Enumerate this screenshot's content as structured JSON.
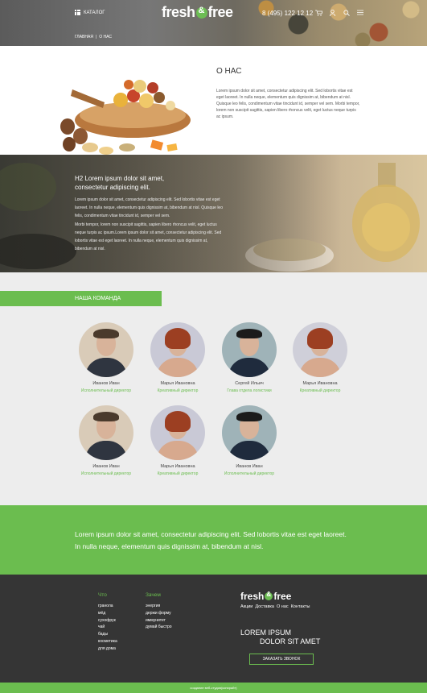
{
  "header": {
    "catalog_label": "КАТАЛОГ",
    "logo_left": "fresh",
    "logo_right": "free",
    "phone": "8 (495) 122 12 12",
    "icons": [
      "cart-icon",
      "user-icon",
      "search-icon",
      "menu-icon"
    ],
    "breadcrumbs": [
      "ГЛАВНАЯ",
      "|",
      "О НАС"
    ]
  },
  "about": {
    "title": "О НАС",
    "text": "Lorem ipsum dolor sit amet, consectetur adipiscing elit. Sed lobortis vitae est eget laoreet. In nulla neque, elementum quis dignissim at, bibendum at nisl. Quisque leo felis, condimentum vitae tincidunt id, semper vel sem. Morbi tempor, lorem non suscipit sagittis, sapien libero rhoncus velit, eget luctus neque turpis ac ipsum."
  },
  "spa": {
    "heading": "H2 Lorem ipsum dolor sit amet, consectetur adipiscing elit.",
    "p1": "Lorem ipsum dolor sit amet, consectetur adipiscing elit. Sed lobortis vitae est eget laoreet. In nulla neque, elementum quis dignissim at, bibendum at nisl. Quisque leo felis, condimentum vitae tincidunt id, semper vel sem.",
    "p2": "Morbi tempor, lorem non suscipit sagittis, sapien libero rhoncus velit, eget luctus neque turpis ac ipsum.Lorem ipsum dolor sit amet, consectetur adipiscing elit. Sed lobortis vitae est eget laoreet. In nulla neque, elementum quis dignissim at, bibendum at nisl."
  },
  "team": {
    "title": "НАША КОМАНДА",
    "members": [
      {
        "name": "Иванов Иван",
        "role": "Исполнительный директор"
      },
      {
        "name": "Марья Ивановна",
        "role": "Креативный директор"
      },
      {
        "name": "Сергей Ильич",
        "role": "Глава отдела логистики"
      },
      {
        "name": "Марья Ивановна",
        "role": "Креативный директор"
      },
      {
        "name": "Иванов Иван",
        "role": "Исполнительный директор"
      },
      {
        "name": "Марья Ивановна",
        "role": "Креативный директор"
      },
      {
        "name": "Иванов Иван",
        "role": "Исполнительный директор"
      }
    ]
  },
  "quote": {
    "text": "Lorem ipsum dolor sit amet, consectetur adipiscing elit. Sed lobortis vitae est eget laoreet. In nulla neque, elementum quis dignissim at, bibendum at nisl."
  },
  "footer": {
    "col1_title": "Что",
    "col1_items": [
      "гранола",
      "мёд",
      "сухофрук",
      "чай",
      "бады",
      "косметика",
      "для дома"
    ],
    "col2_title": "Зачем",
    "col2_items": [
      "энергия",
      "держи форму",
      "иммунитет",
      "думай быстро"
    ],
    "logo_left": "fresh",
    "logo_right": "free",
    "nav": [
      "Акции",
      "Доставка",
      "О нас",
      "Контакты"
    ],
    "big_line1": "LOREM IPSUM",
    "big_line2": "DOLOR SIT AMET",
    "button": "ЗАКАЗАТЬ ЗВОНОК",
    "bottom": "создание веб-студия(копирайт)"
  },
  "colors": {
    "accent": "#6bbd4f",
    "footer_bg": "#353535",
    "page_bg": "#ededed"
  }
}
